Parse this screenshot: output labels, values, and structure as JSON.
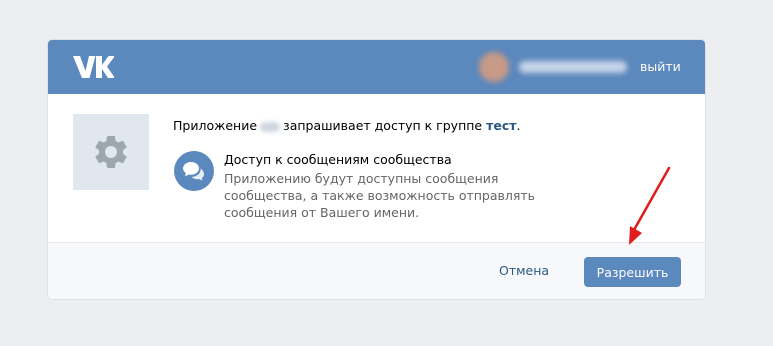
{
  "header": {
    "logo": "vk-logo",
    "logout_label": "выйти"
  },
  "request": {
    "text_before": "Приложение",
    "text_middle": "запрашивает доступ к группе",
    "group_name": "тест",
    "punct": "."
  },
  "permission": {
    "icon": "messages-icon",
    "title": "Доступ к сообщениям сообщества",
    "description": "Приложению будут доступны сообщения сообщества, а также возможность отправлять сообщения от Вашего имени."
  },
  "footer": {
    "cancel_label": "Отмена",
    "allow_label": "Разрешить"
  },
  "colors": {
    "brand": "#5b88bd",
    "link": "#2a5885",
    "background": "#edeef0",
    "annotation_arrow": "#e01e1e"
  }
}
